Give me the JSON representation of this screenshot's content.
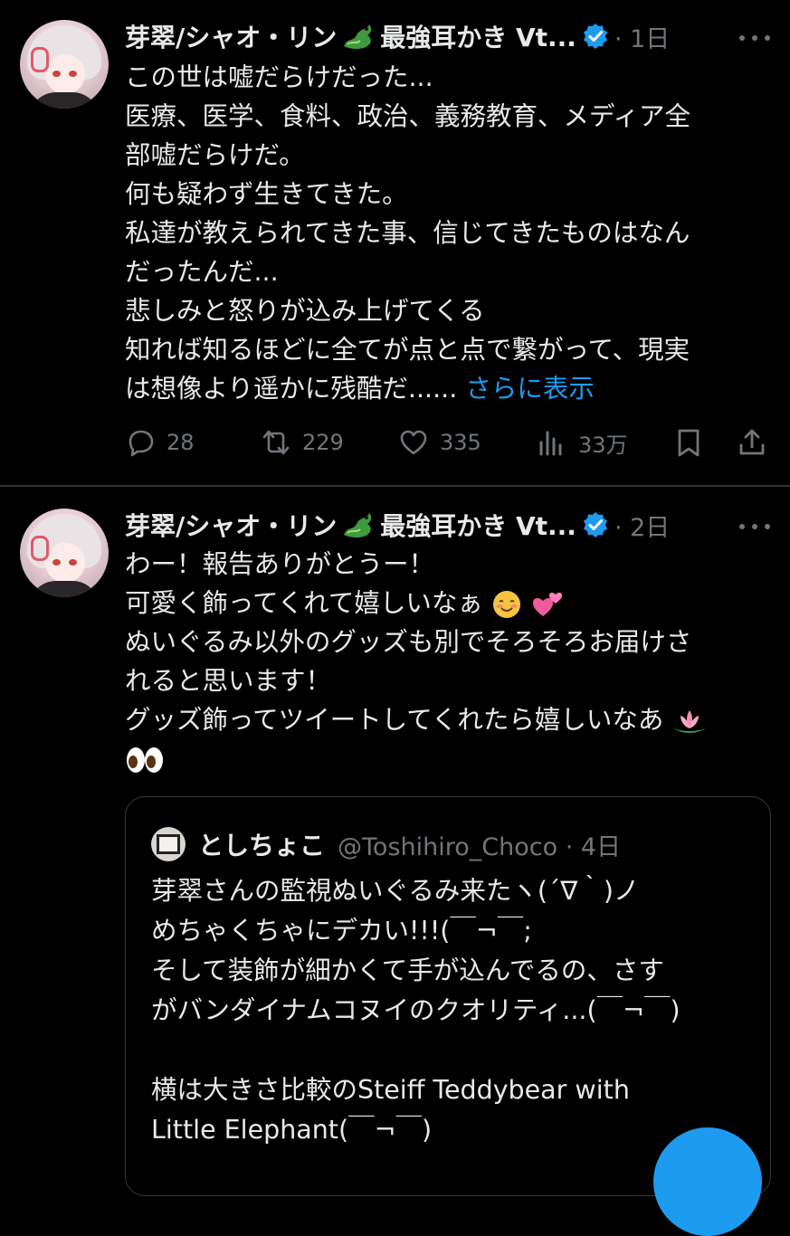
{
  "tweets": [
    {
      "author_name": "芽翠/シャオ・リン",
      "author_name_tail": "最強耳かき Vt...",
      "time": "1日",
      "lines": [
        "この世は嘘だらけだった...",
        "医療、医学、食料、政治、義務教育、メディア全",
        "部嘘だらけだ。",
        "何も疑わず生きてきた。",
        "私達が教えられてきた事、信じてきたものはなん",
        "だったんだ...",
        "悲しみと怒りが込み上げてくる",
        "知れば知るほどに全てが点と点で繋がって、現実",
        "は想像より遥かに残酷だ...... "
      ],
      "show_more": "さらに表示",
      "stats": {
        "replies": "28",
        "retweets": "229",
        "likes": "335",
        "views": "33万"
      }
    },
    {
      "author_name": "芽翠/シャオ・リン",
      "author_name_tail": "最強耳かき Vt...",
      "time": "2日",
      "lines": [
        "わー！報告ありがとうー！",
        "可愛く飾ってくれて嬉しいなぁ",
        "ぬいぐるみ以外のグッズも別でそろそろお届けさ",
        "れると思います！",
        "グッズ飾ってツイートしてくれたら嬉しいなあ"
      ],
      "quote": {
        "name": "としちょこ",
        "handle": "@Toshihiro_Choco",
        "time": "4日",
        "lines": [
          "芽翠さんの監視ぬいぐるみ来たヽ(´∇｀)ノ",
          "めちゃくちゃにデカい!!!(￣¬￣;",
          "そして装飾が細かくて手が込んでるの、さす",
          "がバンダイナムコヌイのクオリティ...(￣¬￣)",
          "",
          "横は大きさ比較のSteiff Teddybear with",
          "Little Elephant(￣¬￣)"
        ]
      }
    }
  ],
  "colors": {
    "accent": "#1d9bf0",
    "muted": "#71767b",
    "text": "#e7e9ea",
    "border": "#2f3336"
  }
}
